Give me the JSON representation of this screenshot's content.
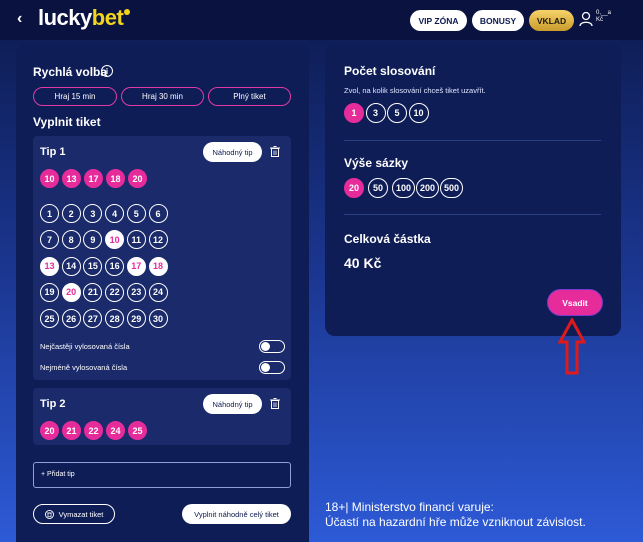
{
  "header": {
    "logo_part1": "lucky",
    "logo_part2": "bet",
    "vip_label": "VIP ZÓNA",
    "bonus_label": "BONUSY",
    "deposit_label": "VKLAD",
    "user_line1": "0,__a",
    "user_line2": "Kč"
  },
  "quick": {
    "title": "Rychlá volba",
    "options": [
      "Hraj 15 min",
      "Hraj 30 min",
      "Plný tiket"
    ]
  },
  "fill": {
    "title": "Vyplnit tiket"
  },
  "tip1": {
    "label": "Tip 1",
    "random_label": "Náhodný tip",
    "selected": [
      10,
      13,
      17,
      18,
      20
    ],
    "grid": [
      1,
      2,
      3,
      4,
      5,
      6,
      7,
      8,
      9,
      10,
      11,
      12,
      13,
      14,
      15,
      16,
      17,
      18,
      19,
      20,
      21,
      22,
      23,
      24,
      25,
      26,
      27,
      28,
      29,
      30
    ],
    "frequent_label": "Nejčastěji vylosovaná čísla",
    "least_label": "Nejméně vylosovaná čísla"
  },
  "tip2": {
    "label": "Tip 2",
    "random_label": "Náhodný tip",
    "selected": [
      20,
      21,
      22,
      24,
      25
    ]
  },
  "add_tip_label": "+ Přidat tip",
  "clear_label": "Vymazat tiket",
  "random_full_label": "Vyplnit náhodně celý tiket",
  "draws": {
    "title": "Počet slosování",
    "subtitle": "Zvol, na kolik slosování chceš tiket uzavřít.",
    "options": [
      "1",
      "3",
      "5",
      "10"
    ],
    "selected": "1"
  },
  "stake": {
    "title": "Výše sázky",
    "options": [
      "20",
      "50",
      "100",
      "200",
      "500"
    ],
    "selected": "20"
  },
  "total": {
    "title": "Celková částka",
    "amount": "40 Kč"
  },
  "bet_label": "Vsadit",
  "disclaimer": {
    "line1": "18+| Ministerstvo financí varuje:",
    "line2": "Účastí na hazardní hře může vzniknout závislost."
  },
  "colors": {
    "accent_pink": "#e62c9b",
    "panel": "#0f1d57",
    "gold": "#f2d41c"
  }
}
